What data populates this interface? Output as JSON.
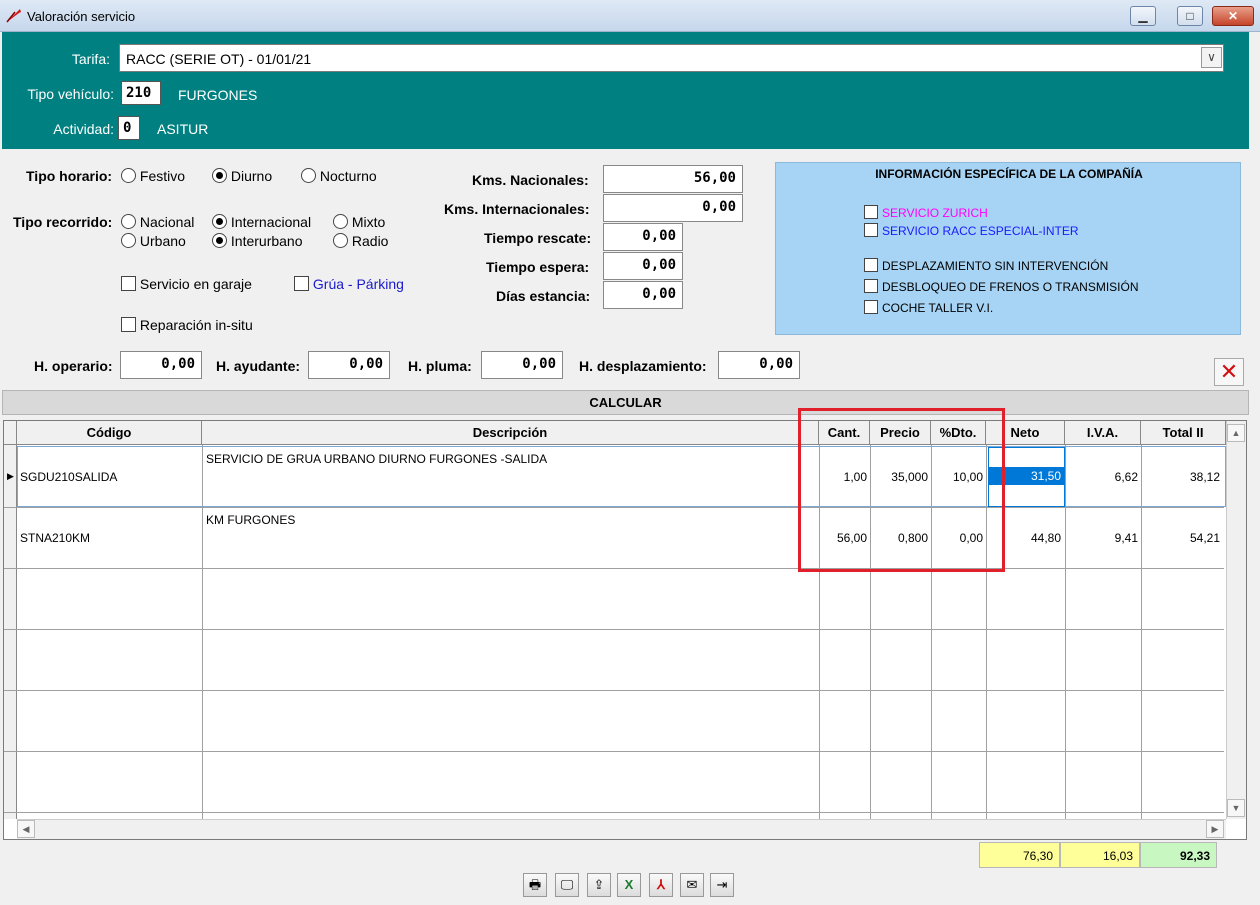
{
  "window": {
    "title": "Valoración servicio"
  },
  "header": {
    "tarifa_label": "Tarifa:",
    "tarifa_value": "RACC (SERIE OT) - 01/01/21",
    "tipo_vehiculo_label": "Tipo vehículo:",
    "tipo_vehiculo_code": "210",
    "tipo_vehiculo_name": "FURGONES",
    "actividad_label": "Actividad:",
    "actividad_code": "0",
    "actividad_name": "ASITUR"
  },
  "options": {
    "tipo_horario_label": "Tipo horario:",
    "horario": [
      "Festivo",
      "Diurno",
      "Nocturno"
    ],
    "horario_selected": "Diurno",
    "tipo_recorrido_label": "Tipo recorrido:",
    "recorrido_a": [
      "Nacional",
      "Internacional",
      "Mixto"
    ],
    "recorrido_b": [
      "Urbano",
      "Interurbano",
      "Radio"
    ],
    "recorrido_selected": [
      "Internacional",
      "Interurbano"
    ],
    "servicio_garaje": "Servicio en garaje",
    "grua_parking": "Grúa - Párking",
    "reparacion_insitu": "Reparación in-situ"
  },
  "distances": {
    "kms_nacionales_label": "Kms. Nacionales:",
    "kms_nacionales": "56,00",
    "kms_internacionales_label": "Kms. Internacionales:",
    "kms_internacionales": "0,00",
    "tiempo_rescate_label": "Tiempo rescate:",
    "tiempo_rescate": "0,00",
    "tiempo_espera_label": "Tiempo espera:",
    "tiempo_espera": "0,00",
    "dias_estancia_label": "Días estancia:",
    "dias_estancia": "0,00"
  },
  "company": {
    "title": "INFORMACIÓN ESPECÍFICA DE LA COMPAÑÍA",
    "servicio_zurich": "SERVICIO ZURICH",
    "servicio_racc": "SERVICIO RACC ESPECIAL-INTER",
    "desplazamiento": "DESPLAZAMIENTO SIN INTERVENCIÓN",
    "desbloqueo": "DESBLOQUEO DE FRENOS O TRANSMISIÓN",
    "coche_taller": "COCHE TALLER V.I.",
    "zurich_color": "#ff00ff",
    "racc_color": "#1a1aff",
    "panel_color": "#a7d4f5"
  },
  "hours": {
    "operario_label": "H. operario:",
    "operario": "0,00",
    "ayudante_label": "H. ayudante:",
    "ayudante": "0,00",
    "pluma_label": "H. pluma:",
    "pluma": "0,00",
    "desplazamiento_label": "H. desplazamiento:",
    "desplazamiento": "0,00"
  },
  "calcular_label": "CALCULAR",
  "grid": {
    "columns": [
      "Código",
      "Descripción",
      "Cant.",
      "Precio",
      "%Dto.",
      "Neto",
      "I.V.A.",
      "Total II"
    ],
    "rows": [
      {
        "codigo": "SGDU210SALIDA",
        "descripcion": "SERVICIO DE GRUA URBANO DIURNO FURGONES -SALIDA",
        "cant": "1,00",
        "precio": "35,000",
        "dto": "10,00",
        "neto": "31,50",
        "iva": "6,62",
        "total": "38,12"
      },
      {
        "codigo": "STNA210KM",
        "descripcion": "KM FURGONES",
        "cant": "56,00",
        "precio": "0,800",
        "dto": "0,00",
        "neto": "44,80",
        "iva": "9,41",
        "total": "54,21"
      }
    ]
  },
  "totals": {
    "neto": "76,30",
    "iva": "16,03",
    "total": "92,33"
  },
  "toolbar_icons": [
    "printer-icon",
    "preview-icon",
    "export-icon",
    "excel-icon",
    "pdf-icon",
    "email-icon",
    "exit-icon"
  ],
  "colors": {
    "header_bg": "#008080",
    "highlight": "#e0202a",
    "selected_cell": "#0078d7"
  }
}
